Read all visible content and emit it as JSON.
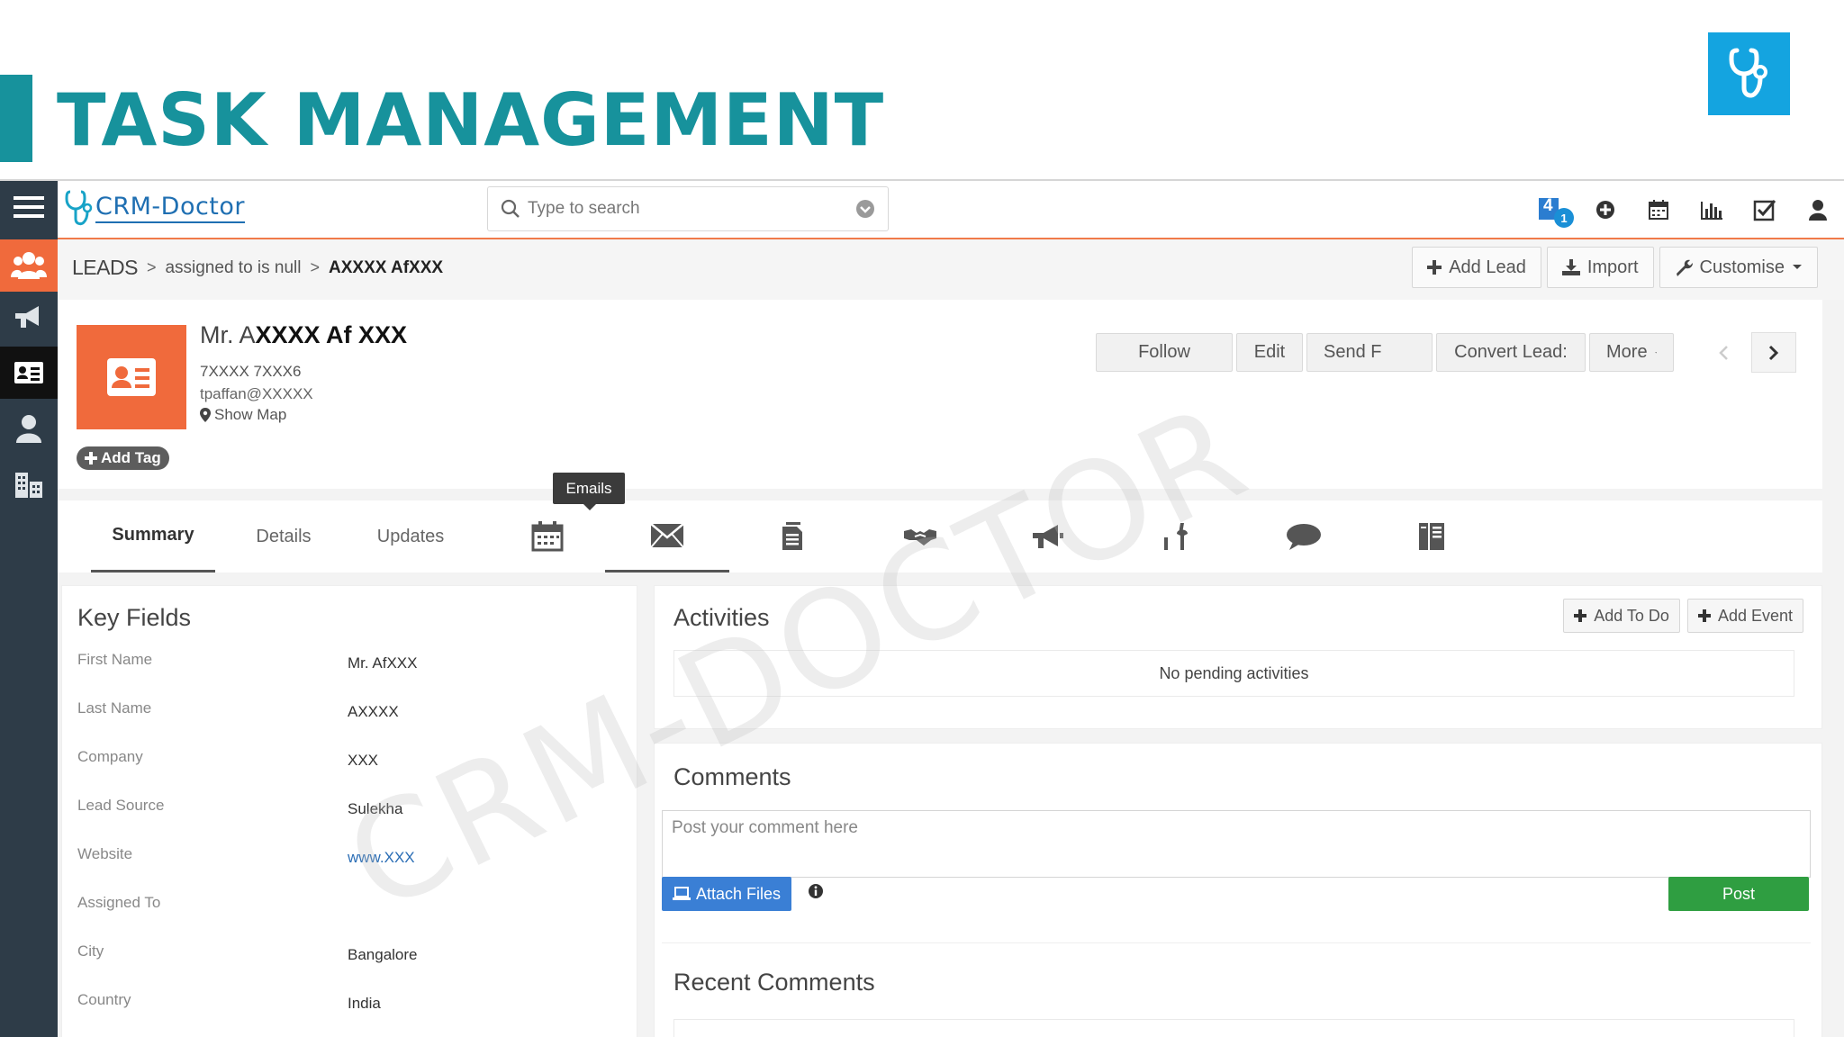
{
  "slide": {
    "title": "TASK MANAGEMENT"
  },
  "app": {
    "brand": "CRM-Doctor",
    "search": {
      "placeholder": "Type to search"
    },
    "notifications": {
      "count": "4",
      "badge": "1"
    },
    "breadcrumb": {
      "root": "LEADS",
      "filter": "assigned to is null",
      "current": "AXXXX AfXXX"
    },
    "header_actions": {
      "add_lead": "Add Lead",
      "import": "Import",
      "customise": "Customise"
    },
    "lead": {
      "name_prefix": "Mr. A",
      "name_masked": "XXXX Af XXX",
      "phone": "7XXXX 7XXX6",
      "email": "tpaffan@XXXXX",
      "show_map": "Show Map",
      "add_tag": "Add Tag"
    },
    "lead_actions": {
      "follow": "Follow",
      "edit": "Edit",
      "send": "Send F",
      "convert": "Convert Lead:",
      "more": "More"
    },
    "tabs": {
      "summary": "Summary",
      "details": "Details",
      "updates": "Updates",
      "tooltip": "Emails"
    },
    "key_fields": {
      "title": "Key Fields",
      "rows": [
        {
          "label": "First Name",
          "value": "Mr. AfXXX"
        },
        {
          "label": "Last Name",
          "value": "AXXXX"
        },
        {
          "label": "Company",
          "value": "XXX"
        },
        {
          "label": "Lead Source",
          "value": "Sulekha"
        },
        {
          "label": "Website",
          "value": "www.XXX"
        },
        {
          "label": "Assigned To",
          "value": ""
        },
        {
          "label": "City",
          "value": "Bangalore"
        },
        {
          "label": "Country",
          "value": "India"
        }
      ]
    },
    "activities": {
      "title": "Activities",
      "add_todo": "Add To Do",
      "add_event": "Add Event",
      "empty": "No pending activities"
    },
    "comments": {
      "title": "Comments",
      "placeholder": "Post your comment here",
      "attach": "Attach Files",
      "post": "Post",
      "recent_title": "Recent Comments"
    },
    "watermark": "CRM-DOCTOR"
  }
}
